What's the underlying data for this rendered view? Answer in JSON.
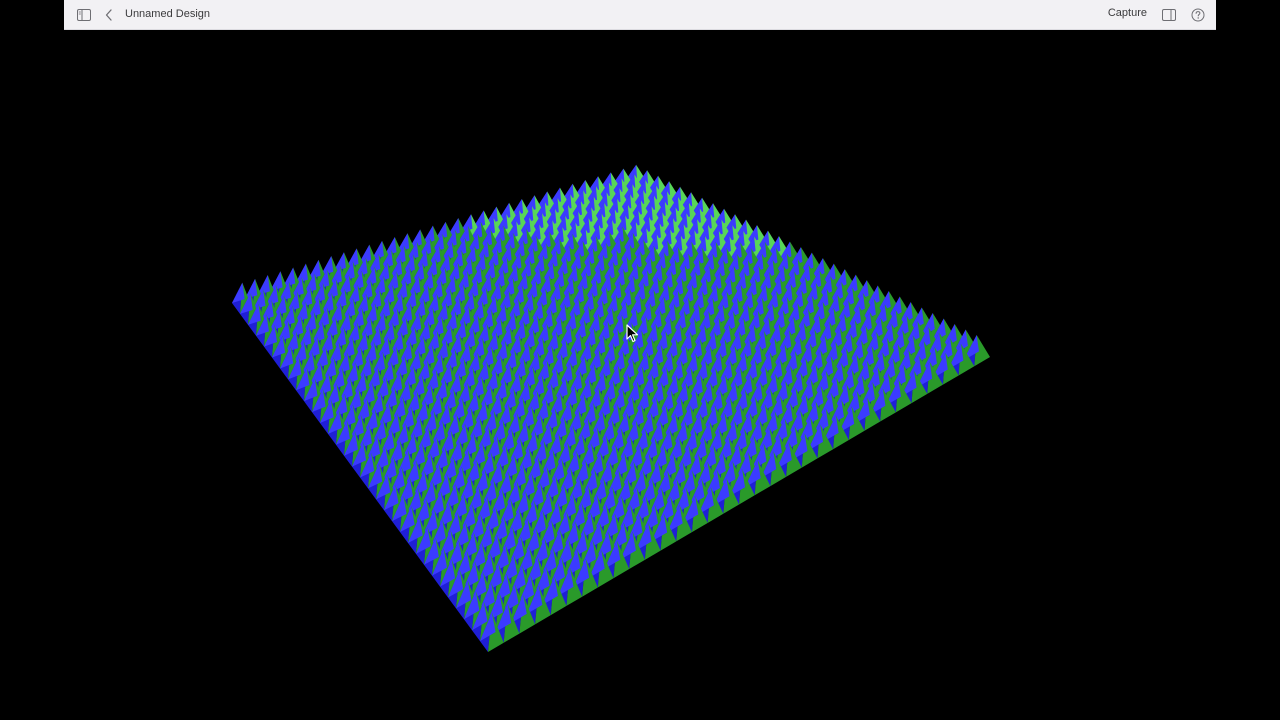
{
  "toolbar": {
    "document_title": "Unnamed Design",
    "capture_label": "Capture",
    "icons": {
      "sidebar": "sidebar-icon",
      "back": "chevron-left-icon",
      "inspector": "inspector-icon",
      "help": "help-icon"
    }
  },
  "scene": {
    "background": "#000000",
    "spike_colors": [
      "#1f1fd6",
      "#2a9a2a",
      "#3b3bff",
      "#58d658"
    ]
  }
}
